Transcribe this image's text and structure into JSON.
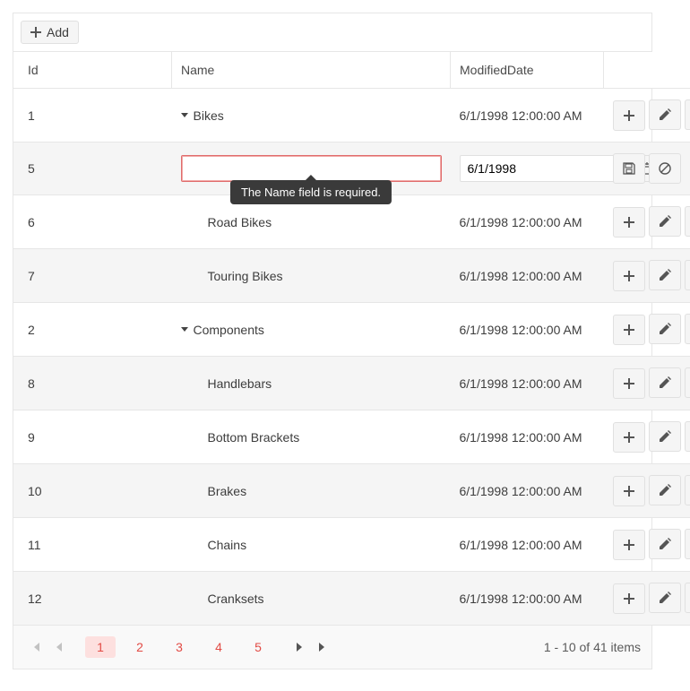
{
  "toolbar": {
    "add_label": "Add"
  },
  "headers": {
    "id": "Id",
    "name": "Name",
    "date": "ModifiedDate"
  },
  "tooltip": "The Name field is required.",
  "rows": [
    {
      "id": "1",
      "name": "Bikes",
      "date": "6/1/1998 12:00:00 AM",
      "level": 0,
      "expandable": true,
      "editing": false
    },
    {
      "id": "5",
      "name": "",
      "date_value": "6/1/1998",
      "level": 1,
      "expandable": false,
      "editing": true
    },
    {
      "id": "6",
      "name": "Road Bikes",
      "date": "6/1/1998 12:00:00 AM",
      "level": 1,
      "expandable": false,
      "editing": false
    },
    {
      "id": "7",
      "name": "Touring Bikes",
      "date": "6/1/1998 12:00:00 AM",
      "level": 1,
      "expandable": false,
      "editing": false
    },
    {
      "id": "2",
      "name": "Components",
      "date": "6/1/1998 12:00:00 AM",
      "level": 0,
      "expandable": true,
      "editing": false
    },
    {
      "id": "8",
      "name": "Handlebars",
      "date": "6/1/1998 12:00:00 AM",
      "level": 1,
      "expandable": false,
      "editing": false
    },
    {
      "id": "9",
      "name": "Bottom Brackets",
      "date": "6/1/1998 12:00:00 AM",
      "level": 1,
      "expandable": false,
      "editing": false
    },
    {
      "id": "10",
      "name": "Brakes",
      "date": "6/1/1998 12:00:00 AM",
      "level": 1,
      "expandable": false,
      "editing": false
    },
    {
      "id": "11",
      "name": "Chains",
      "date": "6/1/1998 12:00:00 AM",
      "level": 1,
      "expandable": false,
      "editing": false
    },
    {
      "id": "12",
      "name": "Cranksets",
      "date": "6/1/1998 12:00:00 AM",
      "level": 1,
      "expandable": false,
      "editing": false
    }
  ],
  "pager": {
    "pages": [
      "1",
      "2",
      "3",
      "4",
      "5"
    ],
    "active": "1",
    "info": "1 - 10 of 41 items"
  }
}
